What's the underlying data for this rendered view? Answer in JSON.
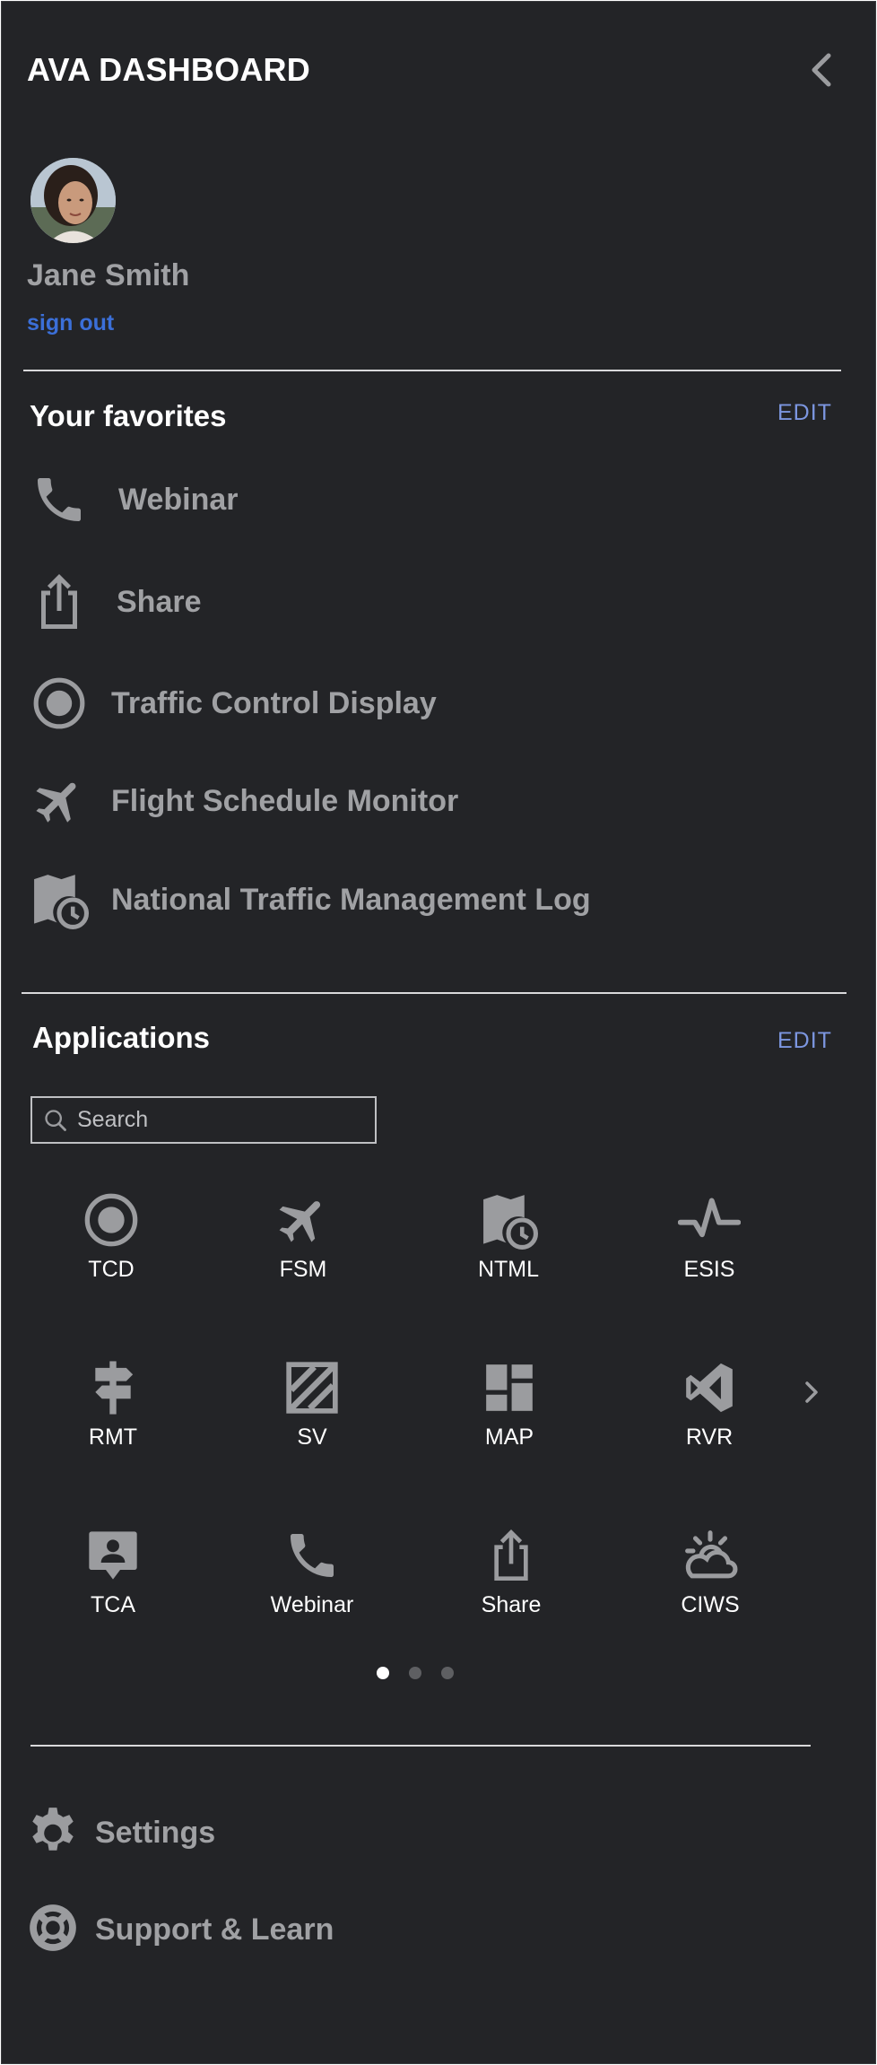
{
  "header": {
    "title": "AVA DASHBOARD"
  },
  "user": {
    "name": "Jane Smith",
    "sign_out": "sign out"
  },
  "favorites": {
    "title": "Your favorites",
    "edit": "EDIT",
    "items": [
      {
        "label": "Webinar",
        "icon": "phone-icon"
      },
      {
        "label": "Share",
        "icon": "share-icon"
      },
      {
        "label": "Traffic Control Display",
        "icon": "radio-target-icon"
      },
      {
        "label": "Flight Schedule Monitor",
        "icon": "airplane-icon"
      },
      {
        "label": "National Traffic Management Log",
        "icon": "map-clock-icon"
      }
    ]
  },
  "applications": {
    "title": "Applications",
    "edit": "EDIT",
    "search_placeholder": "Search",
    "items": [
      {
        "label": "TCD",
        "icon": "radio-target-icon"
      },
      {
        "label": "FSM",
        "icon": "airplane-icon"
      },
      {
        "label": "NTML",
        "icon": "map-clock-icon"
      },
      {
        "label": "ESIS",
        "icon": "pulse-icon"
      },
      {
        "label": "RMT",
        "icon": "signpost-icon"
      },
      {
        "label": "SV",
        "icon": "hatched-square-icon"
      },
      {
        "label": "MAP",
        "icon": "dashboard-grid-icon"
      },
      {
        "label": "RVR",
        "icon": "code-brackets-icon"
      },
      {
        "label": "TCA",
        "icon": "contact-bubble-icon"
      },
      {
        "label": "Webinar",
        "icon": "phone-icon"
      },
      {
        "label": "Share",
        "icon": "share-icon"
      },
      {
        "label": "CIWS",
        "icon": "weather-cloud-icon"
      }
    ],
    "pages": 3,
    "current_page": 1
  },
  "footer": {
    "items": [
      {
        "label": "Settings",
        "icon": "gear-icon"
      },
      {
        "label": "Support & Learn",
        "icon": "lifebuoy-icon"
      }
    ]
  },
  "colors": {
    "panel_bg": "#232427",
    "link": "#3b6fd8",
    "edit": "#7c96e0",
    "icon": "#9b9c9f"
  }
}
